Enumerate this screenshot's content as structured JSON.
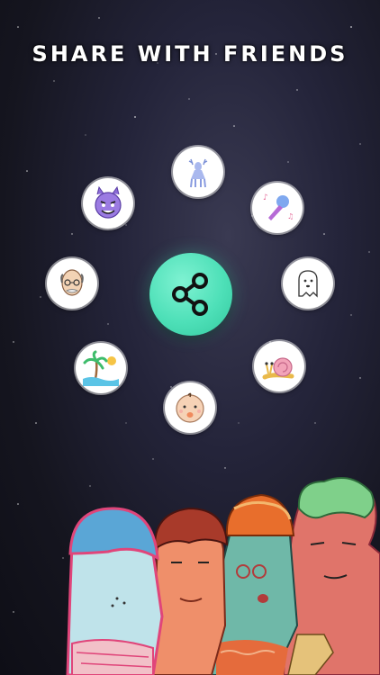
{
  "screen": {
    "title": "SHARE WITH FRIENDS"
  },
  "share_button": {
    "icon": "share-icon",
    "color": "#4ee0b8"
  },
  "stickers": [
    {
      "name": "deer-sticker",
      "icon": "deer-icon"
    },
    {
      "name": "microphone-sticker",
      "icon": "microphone-icon"
    },
    {
      "name": "ghost-sticker",
      "icon": "ghost-icon"
    },
    {
      "name": "snail-sticker",
      "icon": "snail-icon"
    },
    {
      "name": "baby-face-sticker",
      "icon": "baby-face-icon"
    },
    {
      "name": "beach-sticker",
      "icon": "palm-tree-icon"
    },
    {
      "name": "bald-man-sticker",
      "icon": "bald-man-icon"
    },
    {
      "name": "devil-sticker",
      "icon": "devil-icon"
    }
  ],
  "colors": {
    "background": "#1a1a28",
    "accent": "#4ee0b8"
  }
}
